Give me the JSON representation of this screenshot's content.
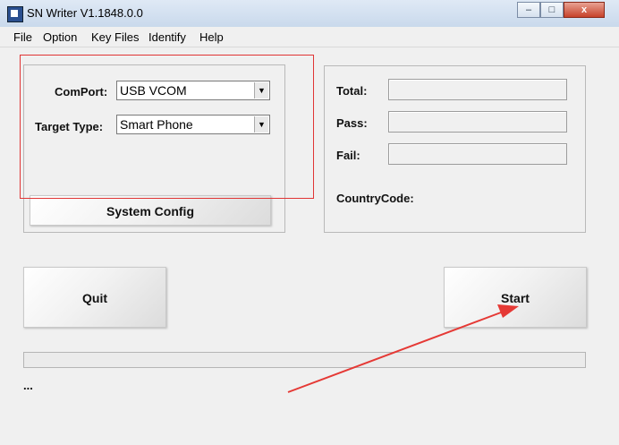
{
  "window": {
    "title": "SN Writer V1.1848.0.0",
    "minimize": "–",
    "maximize": "□",
    "close": "x"
  },
  "menu": [
    "File",
    "Option",
    "Key Files",
    "Identify",
    "Help"
  ],
  "settings": {
    "comport_label": "ComPort:",
    "comport_value": "USB VCOM",
    "target_label": "Target Type:",
    "target_value": "Smart Phone",
    "system_config_label": "System Config"
  },
  "stats": {
    "total_label": "Total:",
    "pass_label": "Pass:",
    "fail_label": "Fail:",
    "countrycode_label": "CountryCode:"
  },
  "actions": {
    "quit_label": "Quit",
    "start_label": "Start"
  },
  "status_text": "...",
  "colors": {
    "annotation": "#e53935",
    "background": "#f0f0f0"
  }
}
